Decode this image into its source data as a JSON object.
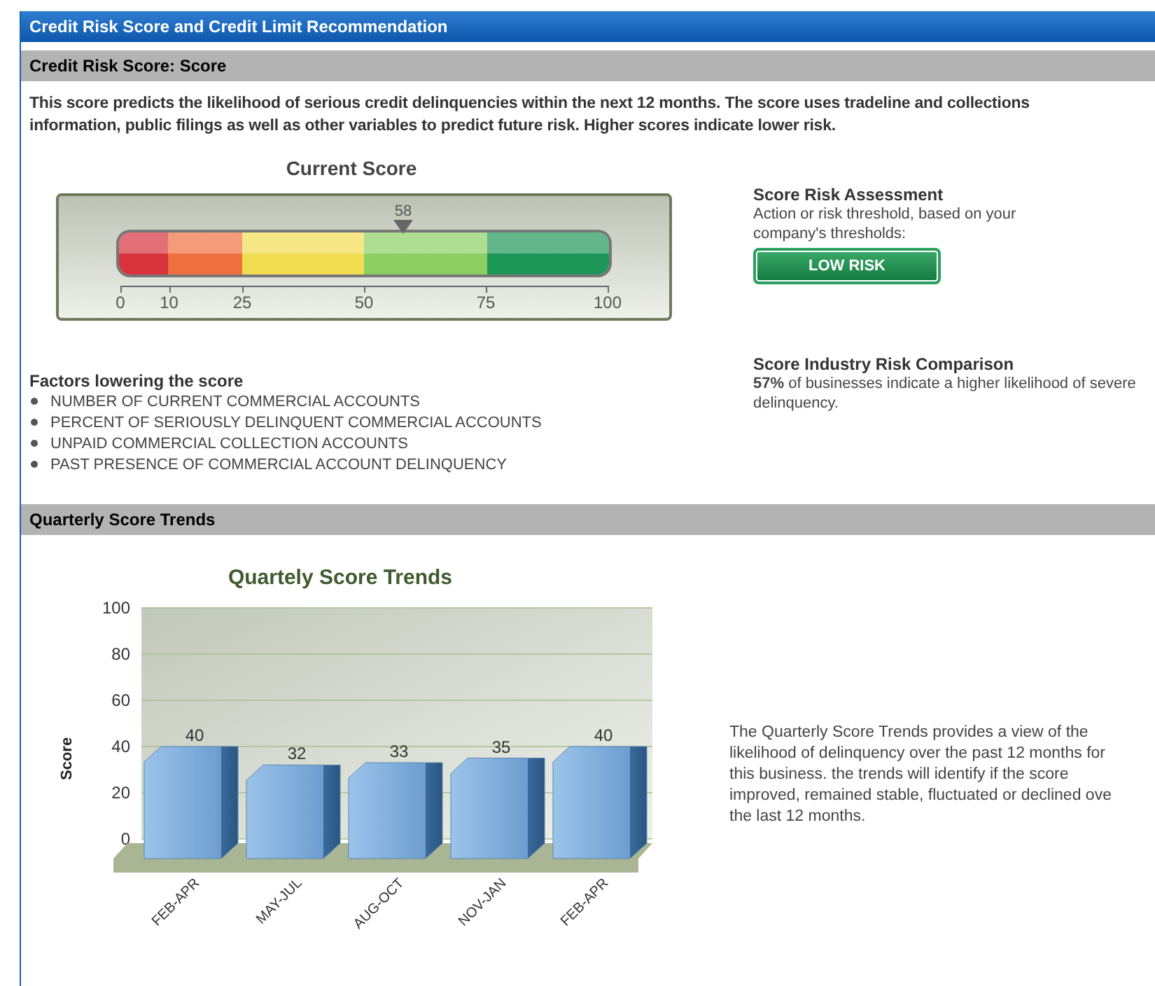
{
  "title": "Credit Risk Score and Credit Limit Recommendation",
  "score_section": {
    "heading": "Credit Risk Score: Score",
    "description": "This score predicts the likelihood of serious credit delinquencies within the next 12 months. The score uses tradeline and collections information, public filings as well as other variables to predict future risk. Higher scores indicate lower risk.",
    "gauge": {
      "title": "Current Score",
      "level": 0.58,
      "reading": "58",
      "ticks": [
        "0",
        "10",
        "25",
        "50",
        "75",
        "100"
      ]
    },
    "assessment": {
      "title": "Score Risk Assessment",
      "text": "Action or risk threshold, based on your company's thresholds:",
      "badge": "LOW RISK"
    },
    "factors": {
      "title": "Factors lowering the score",
      "items": [
        "NUMBER OF CURRENT COMMERCIAL ACCOUNTS",
        "PERCENT OF SERIOUSLY DELINQUENT COMMERCIAL ACCOUNTS",
        "UNPAID COMMERCIAL COLLECTION ACCOUNTS",
        "PAST PRESENCE OF COMMERCIAL ACCOUNT DELINQUENCY"
      ]
    },
    "comparison": {
      "title": "Score Industry Risk Comparison",
      "text": "**57%** of businesses indicate a higher likelihood of severe delinquency."
    }
  },
  "trends_section": {
    "heading": "Quarterly Score Trends",
    "chart_data": {
      "type": "bar",
      "title": "Quartely Score Trends",
      "ylabel": "Score",
      "categories": [
        "FEB-APR",
        "MAY-JUL",
        "AUG-OCT",
        "NOV-JAN",
        "FEB-APR"
      ],
      "values": [
        40,
        32,
        33,
        35,
        40
      ],
      "ylim": [
        0,
        100
      ],
      "yticks": [
        0,
        20,
        40,
        60,
        80,
        100
      ],
      "grid": true,
      "data_labels": true
    },
    "description": "The Quarterly Score Trends provides a view of the\nlikelihood of delinquency over the past 12 months for\nthis business. the trends will identify if the score\nimproved, remained stable, fluctuated or declined ove\nthe last 12 months."
  }
}
